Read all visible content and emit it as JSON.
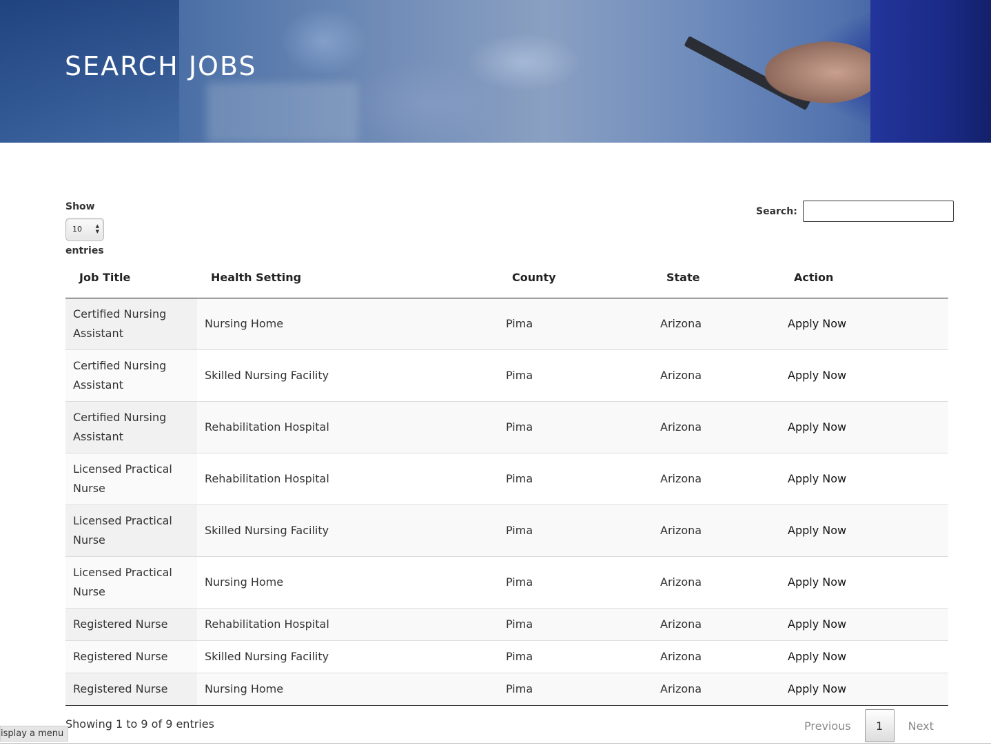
{
  "hero": {
    "title": "SEARCH JOBS"
  },
  "length": {
    "show_label": "Show",
    "value": "10",
    "entries_label": "entries"
  },
  "search": {
    "label": "Search:",
    "value": ""
  },
  "table": {
    "headers": [
      "Job Title",
      "Health Setting",
      "County",
      "State",
      "Action"
    ],
    "rows": [
      [
        "Certified Nursing Assistant",
        "Nursing Home",
        "Pima",
        "Arizona",
        "Apply Now"
      ],
      [
        "Certified Nursing Assistant",
        "Skilled Nursing Facility",
        "Pima",
        "Arizona",
        "Apply Now"
      ],
      [
        "Certified Nursing Assistant",
        "Rehabilitation Hospital",
        "Pima",
        "Arizona",
        "Apply Now"
      ],
      [
        "Licensed Practical Nurse",
        "Rehabilitation Hospital",
        "Pima",
        "Arizona",
        "Apply Now"
      ],
      [
        "Licensed Practical Nurse",
        "Skilled Nursing Facility",
        "Pima",
        "Arizona",
        "Apply Now"
      ],
      [
        "Licensed Practical Nurse",
        "Nursing Home",
        "Pima",
        "Arizona",
        "Apply Now"
      ],
      [
        "Registered Nurse",
        "Rehabilitation Hospital",
        "Pima",
        "Arizona",
        "Apply Now"
      ],
      [
        "Registered Nurse",
        "Skilled Nursing Facility",
        "Pima",
        "Arizona",
        "Apply Now"
      ],
      [
        "Registered Nurse",
        "Nursing Home",
        "Pima",
        "Arizona",
        "Apply Now"
      ]
    ]
  },
  "info": "Showing 1 to 9 of 9 entries",
  "pager": {
    "previous": "Previous",
    "page": "1",
    "next": "Next"
  },
  "tooltip": "isplay a menu"
}
